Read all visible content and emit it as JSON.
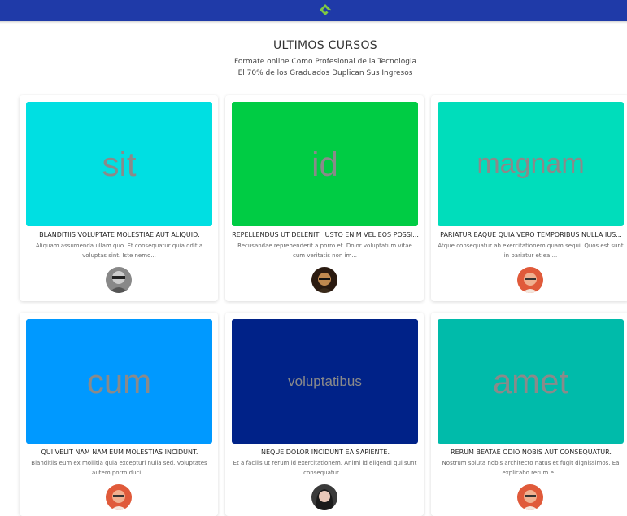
{
  "header": {
    "logo_icon": "diamond-logo-icon"
  },
  "hero": {
    "title": "ULTIMOS CURSOS",
    "subtitle_line1": "Formate online Como Profesional de la Tecnologia",
    "subtitle_line2": "El 70% de los Graduados Duplican Sus Ingresos"
  },
  "courses": [
    {
      "thumb_text": "sit",
      "thumb_color": "#00dfe2",
      "title": "BLANDITIIS VOLUPTATE MOLESTIAE AUT ALIQUID.",
      "desc": "Aliquam assumenda ullam quo. Et consequatur quia odit a voluptas sint. Iste nemo...",
      "avatar": "avatar-man-sunglasses"
    },
    {
      "thumb_text": "id",
      "thumb_color": "#00cc44",
      "title": "REPELLENDUS UT DELENITI IUSTO ENIM VEL EOS POSSI...",
      "desc": "Recusandae reprehenderit a porro et. Dolor voluptatum vitae cum veritatis non im...",
      "avatar": "avatar-man-glasses"
    },
    {
      "thumb_text": "magnam",
      "thumb_color": "#00ddbb",
      "title": "PARIATUR EAQUE QUIA VERO TEMPORIBUS NULLA IUS...",
      "desc": "Atque consequatur ab exercitationem quam sequi. Quos est sunt in pariatur et ea ...",
      "avatar": "avatar-man-red"
    },
    {
      "thumb_text": "cum",
      "thumb_color": "#0099ff",
      "title": "QUI VELIT NAM NAM EUM MOLESTIAS INCIDUNT.",
      "desc": "Blanditiis eum ex mollitia quia excepturi nulla sed. Voluptates autem porro duci...",
      "avatar": "avatar-man-red"
    },
    {
      "thumb_text": "voluptatibus",
      "thumb_color": "#002288",
      "title": "NEQUE DOLOR INCIDUNT EA SAPIENTE.",
      "desc": "Et a facilis ut rerum id exercitationem. Animi id eligendi qui sunt consequatur ...",
      "avatar": "avatar-woman"
    },
    {
      "thumb_text": "amet",
      "thumb_color": "#00bbaa",
      "title": "RERUM BEATAE ODIO NOBIS AUT CONSEQUATUR.",
      "desc": "Nostrum soluta nobis architecto natus et fugit dignissimos. Ea explicabo rerum e...",
      "avatar": "avatar-man-red"
    }
  ]
}
